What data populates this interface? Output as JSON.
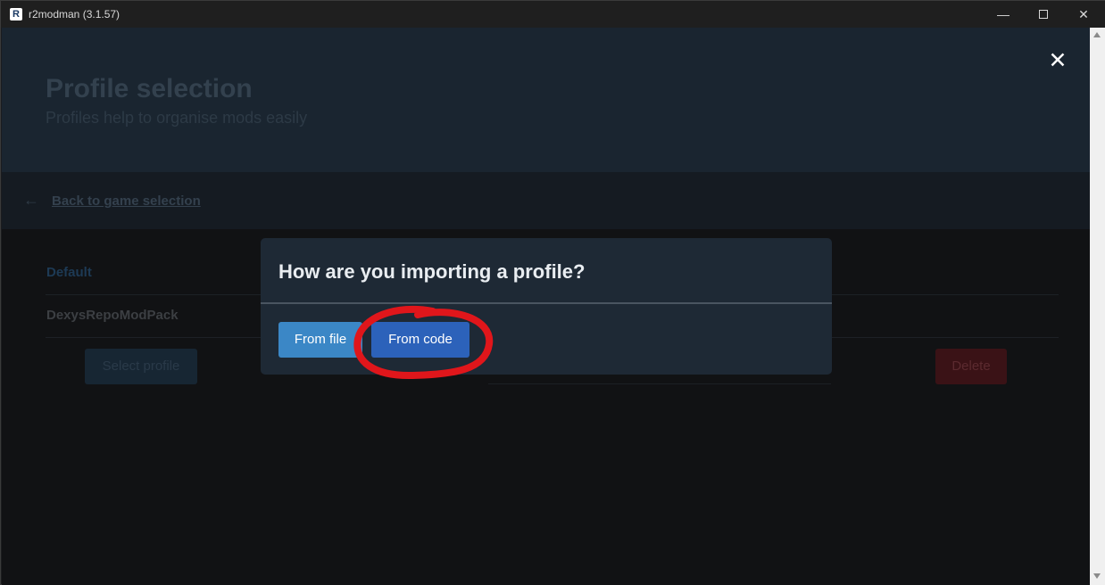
{
  "window": {
    "title": "r2modman (3.1.57)",
    "app_icon_letter": "R",
    "controls": {
      "minimize_glyph": "—",
      "close_glyph": "✕"
    }
  },
  "page": {
    "title": "Profile selection",
    "subtitle": "Profiles help to organise mods easily",
    "back_arrow_glyph": "←",
    "back_link": "Back to game selection",
    "profiles": [
      {
        "name": "Default"
      },
      {
        "name": "DexysRepoModPack"
      }
    ],
    "select_button": "Select profile",
    "delete_button": "Delete"
  },
  "modal": {
    "title": "How are you importing a profile?",
    "close_glyph": "✕",
    "buttons": {
      "from_file": "From file",
      "from_code": "From code"
    },
    "annotation_color": "#e0161b"
  },
  "colors": {
    "accent_blue": "#3b87c6",
    "primary_blue": "#2c62ba",
    "modal_bg": "#1e2935"
  }
}
